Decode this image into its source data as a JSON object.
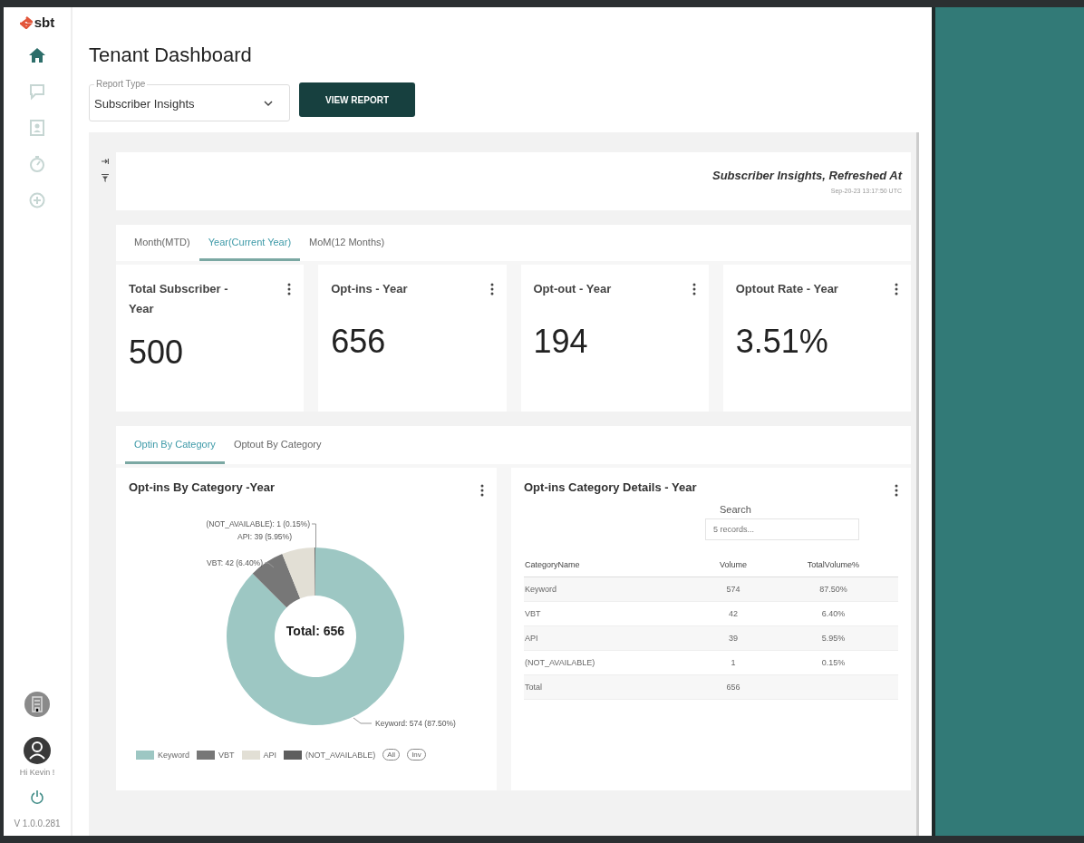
{
  "sidebar": {
    "logo": "sbt",
    "items": [
      {
        "kind": "home",
        "selected": true
      },
      {
        "kind": "chat",
        "selected": false
      },
      {
        "kind": "contact",
        "selected": false
      },
      {
        "kind": "timer",
        "selected": false
      },
      {
        "kind": "settings",
        "selected": false
      }
    ],
    "greeting": "Hi Kevin !",
    "version": "V 1.0.0.281"
  },
  "page_title": "Tenant Dashboard",
  "report_type": {
    "label": "Report Type",
    "value": "Subscriber Insights"
  },
  "view_button": "VIEW REPORT",
  "report_header": {
    "title": "Subscriber Insights, Refreshed At",
    "timestamp": "Sep-20-23 13:17:50 UTC"
  },
  "period_tabs": [
    {
      "label": "Month(MTD)",
      "selected": false
    },
    {
      "label": "Year(Current Year)",
      "selected": true
    },
    {
      "label": "MoM(12 Months)",
      "selected": false
    }
  ],
  "kpis": [
    {
      "title": "Total Subscriber - Year",
      "value": "500"
    },
    {
      "title": "Opt-ins - Year",
      "value": "656"
    },
    {
      "title": "Opt-out - Year",
      "value": "194"
    },
    {
      "title": "Optout Rate - Year",
      "value": "3.51%"
    }
  ],
  "category_tabs": [
    {
      "label": "Optin By Category",
      "selected": true
    },
    {
      "label": "Optout By Category",
      "selected": false
    }
  ],
  "donut_card": {
    "title": "Opt-ins By Category -Year",
    "center_text": "Total: 656",
    "chart_data": {
      "type": "donut",
      "categories": [
        "Keyword",
        "VBT",
        "API",
        "(NOT_AVAILABLE)"
      ],
      "values": [
        574,
        42,
        39,
        1
      ],
      "colors": [
        "#9dc7c3",
        "#777777",
        "#e2dfd5",
        "#5e5e5e"
      ],
      "value_labels": [
        "Keyword: 574 (87.50%)",
        "VBT: 42 (6.40%)",
        "API: 39 (5.95%)",
        "(NOT_AVAILABLE): 1 (0.15%)"
      ]
    },
    "legend_chips": [
      "All",
      "Inv"
    ]
  },
  "details_card": {
    "title": "Opt-ins Category Details - Year",
    "search": {
      "label": "Search",
      "placeholder": "5 records..."
    },
    "columns": [
      "CategoryName",
      "Volume",
      "TotalVolume%"
    ],
    "rows": [
      [
        "Keyword",
        "574",
        "87.50%"
      ],
      [
        "VBT",
        "42",
        "6.40%"
      ],
      [
        "API",
        "39",
        "5.95%"
      ],
      [
        "(NOT_AVAILABLE)",
        "1",
        "0.15%"
      ],
      [
        "Total",
        "656",
        ""
      ]
    ]
  }
}
